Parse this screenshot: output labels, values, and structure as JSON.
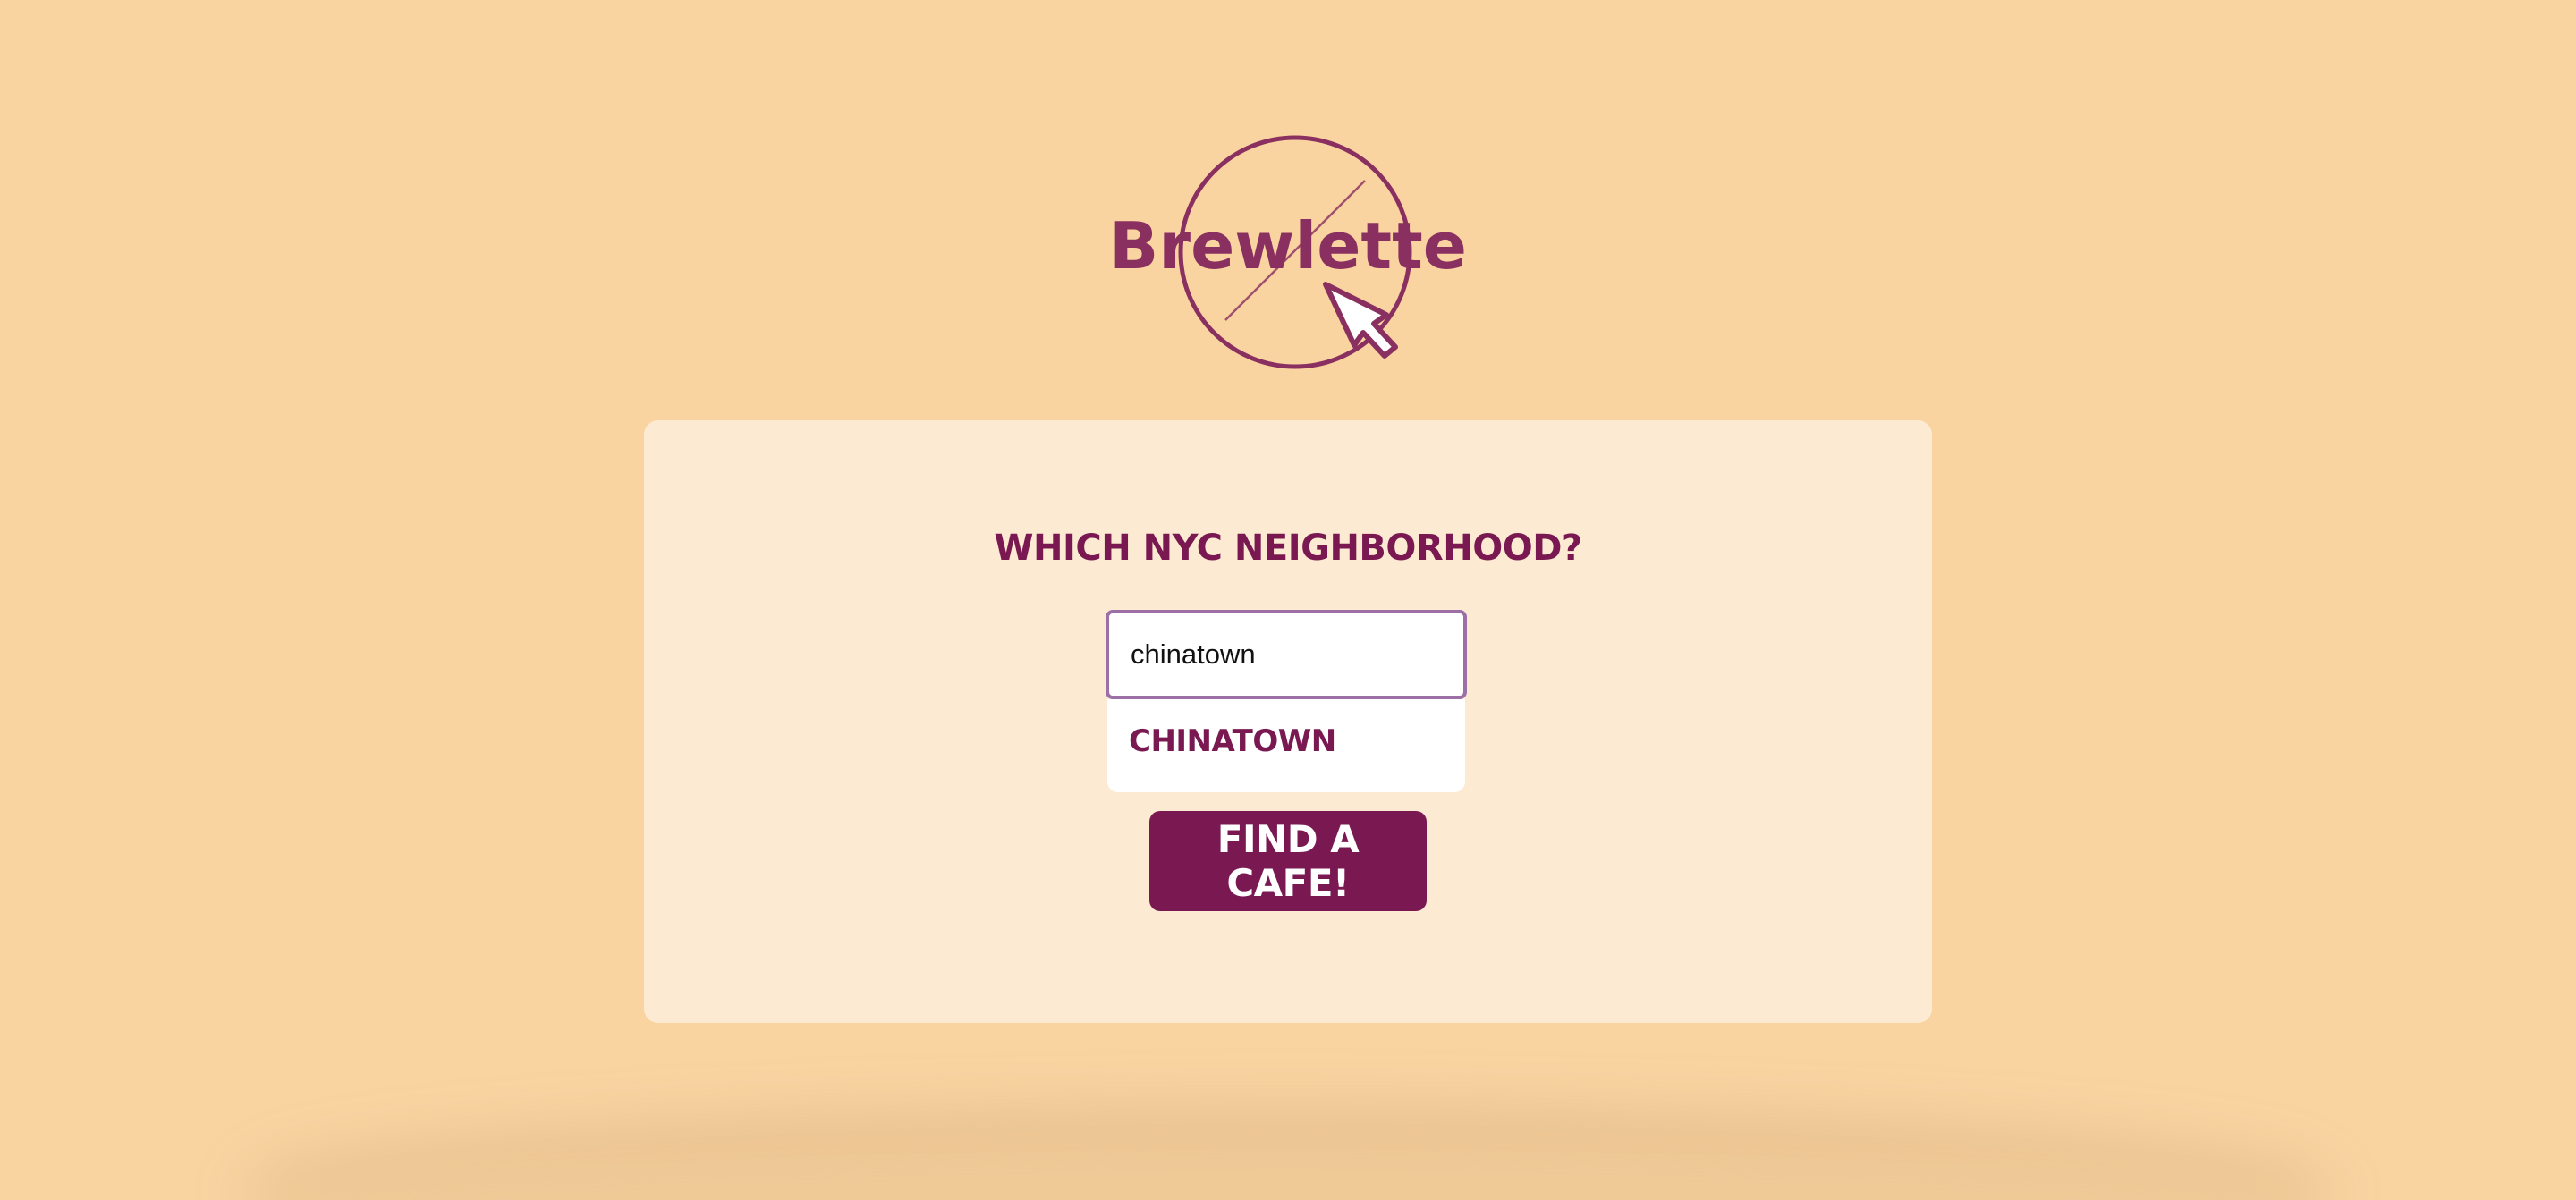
{
  "app": {
    "logo_text": "Brewlette"
  },
  "colors": {
    "background": "#f9d4a1",
    "card": "#fcebd2",
    "brand": "#7a1852",
    "logo": "#8a3060",
    "input_border": "#9c6fa6"
  },
  "search": {
    "question": "Which NYC neighborhood?",
    "value": "chinatown",
    "suggestions": [
      "Chinatown"
    ]
  },
  "actions": {
    "find_label": "Find a cafe!"
  },
  "icons": {
    "logo_pointer": "cursor-arrow-icon"
  }
}
